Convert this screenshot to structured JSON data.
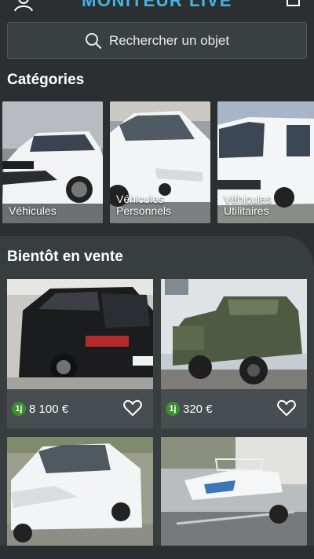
{
  "header": {
    "brand": "MONITEUR LIVE",
    "icons": [
      "user-icon",
      "cart-icon"
    ]
  },
  "search": {
    "placeholder": "Rechercher un objet",
    "icon": "search-icon"
  },
  "categories": {
    "title": "Catégories",
    "items": [
      {
        "label": "Véhicules"
      },
      {
        "label_line1": "Véhicules",
        "label_line2": "Personnels"
      },
      {
        "label_line1": "Véhicules",
        "label_line2": "Utilitaires"
      }
    ]
  },
  "soon": {
    "title": "Bientôt en vente",
    "listings": [
      {
        "badge": "1j",
        "price": "8 100 €"
      },
      {
        "badge": "1j",
        "price": "320 €"
      },
      {
        "badge": "",
        "price": ""
      },
      {
        "badge": "",
        "price": ""
      }
    ]
  },
  "colors": {
    "background": "#2b2f31",
    "panel": "#383d40",
    "card": "#474d50",
    "badge_green": "#3a8f2c",
    "brand_blue": "#45b3e0"
  }
}
